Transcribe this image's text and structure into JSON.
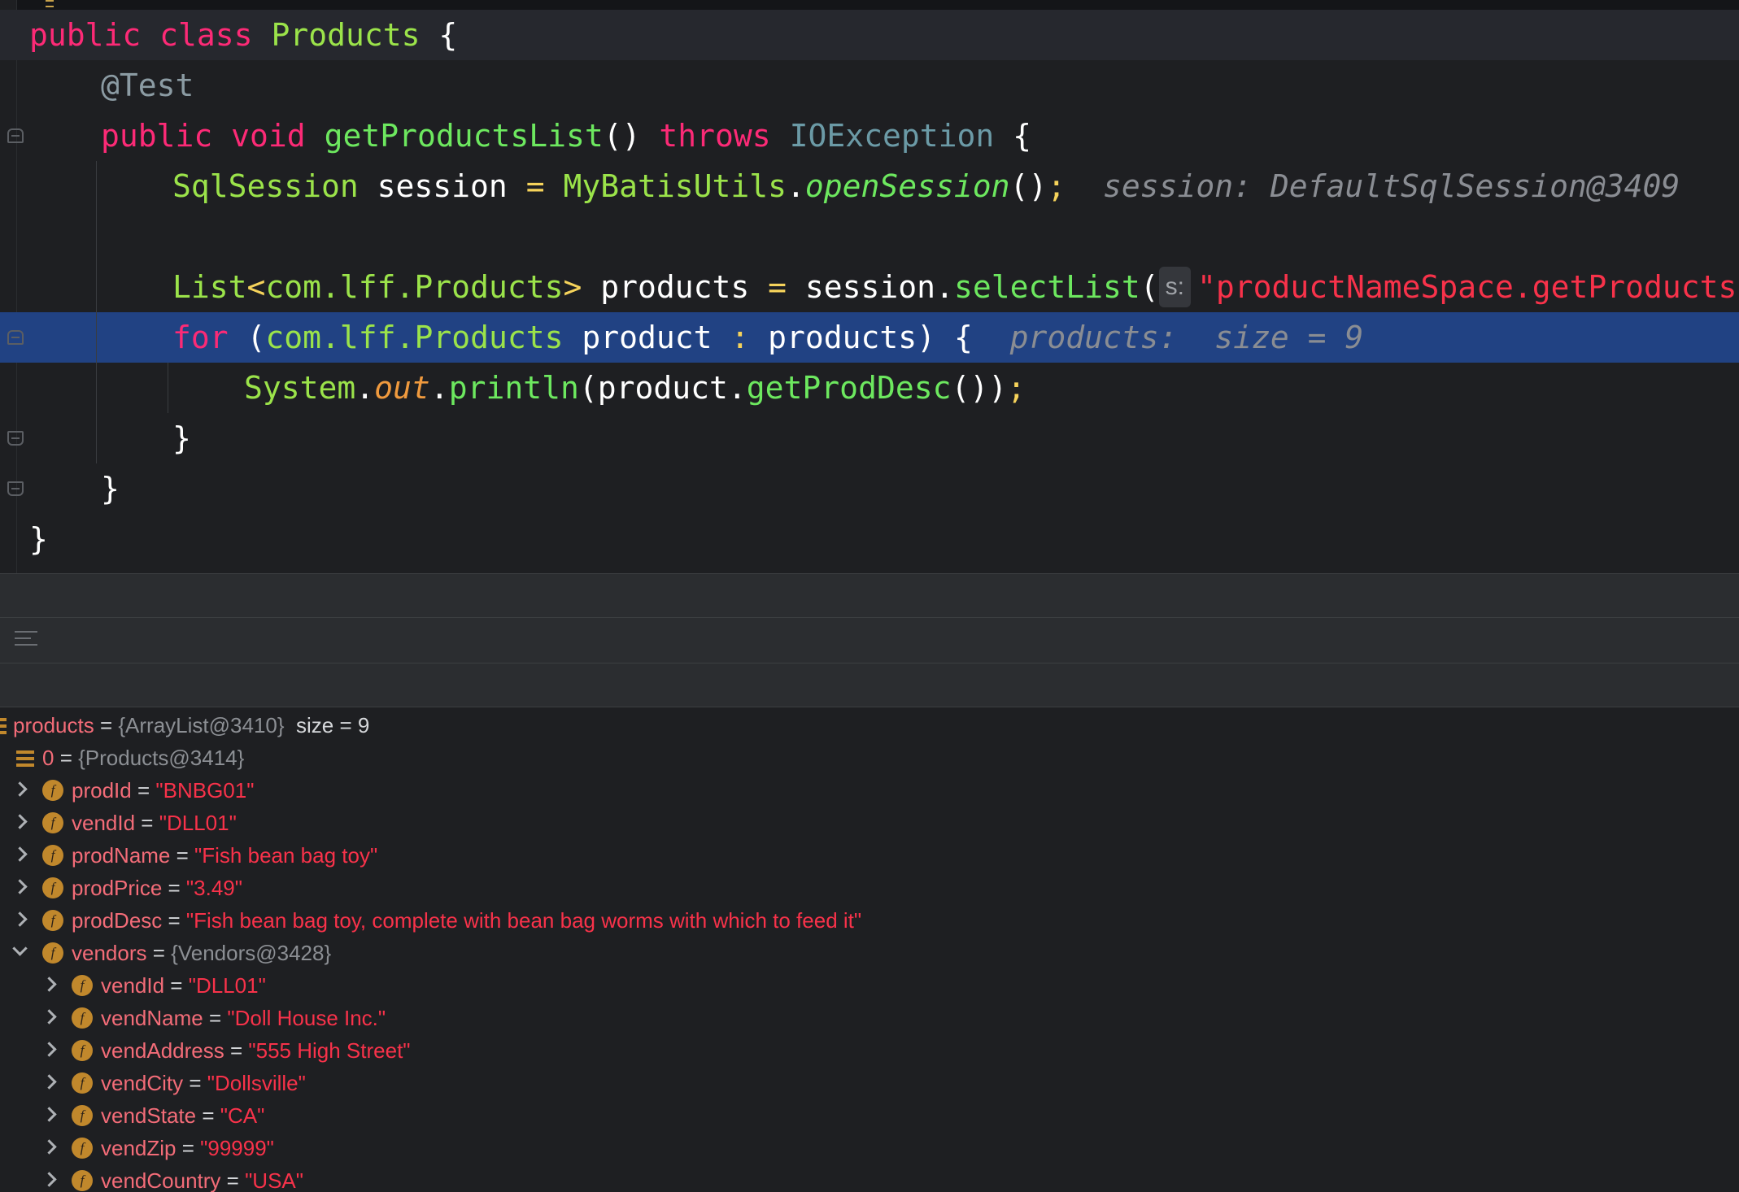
{
  "editor": {
    "lines": [
      {
        "id": "l1",
        "parts": [
          [
            "kw",
            "public"
          ],
          [
            "pl",
            " "
          ],
          [
            "kw",
            "class"
          ],
          [
            "pl",
            " "
          ],
          [
            "cls",
            "Products"
          ],
          [
            "pl",
            " "
          ],
          [
            "br",
            "{"
          ]
        ]
      },
      {
        "id": "l2",
        "parts": [
          [
            "ann",
            "@Test"
          ]
        ]
      },
      {
        "id": "l3",
        "parts": [
          [
            "kw",
            "public"
          ],
          [
            "pl",
            " "
          ],
          [
            "kw",
            "void"
          ],
          [
            "pl",
            " "
          ],
          [
            "fn",
            "getProductsList"
          ],
          [
            "br",
            "()"
          ],
          [
            "pl",
            " "
          ],
          [
            "kw",
            "throws"
          ],
          [
            "pl",
            " "
          ],
          [
            "exc",
            "IOException"
          ],
          [
            "pl",
            " "
          ],
          [
            "br",
            "{"
          ]
        ]
      },
      {
        "id": "l4",
        "parts": [
          [
            "cls",
            "SqlSession"
          ],
          [
            "pl",
            " session "
          ],
          [
            "op",
            "="
          ],
          [
            "pl",
            " "
          ],
          [
            "cls",
            "MyBatisUtils"
          ],
          [
            "pl",
            "."
          ],
          [
            "fni",
            "openSession"
          ],
          [
            "br",
            "()"
          ],
          [
            "op",
            ";"
          ],
          [
            "pl",
            "  "
          ],
          [
            "hint",
            "session: DefaultSqlSession@3409"
          ]
        ]
      },
      {
        "id": "l5",
        "parts": []
      },
      {
        "id": "l6",
        "parts": [
          [
            "cls",
            "List"
          ],
          [
            "op",
            "<"
          ],
          [
            "cls",
            "com.lff.Products"
          ],
          [
            "op",
            ">"
          ],
          [
            "pl",
            " products "
          ],
          [
            "op",
            "="
          ],
          [
            "pl",
            " session"
          ],
          [
            "pl",
            "."
          ],
          [
            "fn",
            "selectList"
          ],
          [
            "br",
            "("
          ],
          [
            "param",
            "s:"
          ],
          [
            "str",
            "\"productNameSpace.getProducts\""
          ],
          [
            "br",
            ")"
          ],
          [
            "op",
            ";"
          ]
        ]
      },
      {
        "id": "l7",
        "parts": [
          [
            "kw",
            "for"
          ],
          [
            "pl",
            " "
          ],
          [
            "br",
            "("
          ],
          [
            "cls",
            "com.lff.Products"
          ],
          [
            "pl",
            " product "
          ],
          [
            "op",
            ":"
          ],
          [
            "pl",
            " products"
          ],
          [
            "br",
            ")"
          ],
          [
            "pl",
            " "
          ],
          [
            "br",
            "{"
          ],
          [
            "pl",
            "  "
          ],
          [
            "hint",
            "products:  size = 9"
          ]
        ]
      },
      {
        "id": "l8",
        "parts": [
          [
            "cls",
            "System"
          ],
          [
            "pl",
            "."
          ],
          [
            "fld",
            "out"
          ],
          [
            "pl",
            "."
          ],
          [
            "fn",
            "println"
          ],
          [
            "br",
            "("
          ],
          [
            "pl",
            "product"
          ],
          [
            "pl",
            "."
          ],
          [
            "fn",
            "getProdDesc"
          ],
          [
            "br",
            "())"
          ],
          [
            "op",
            ";"
          ]
        ]
      },
      {
        "id": "l9",
        "parts": [
          [
            "br",
            "}"
          ]
        ]
      },
      {
        "id": "l10",
        "parts": [
          [
            "br",
            "}"
          ]
        ]
      },
      {
        "id": "l11",
        "parts": [
          [
            "br",
            "}"
          ]
        ]
      }
    ]
  },
  "variables": {
    "rows": [
      {
        "id": "v0",
        "icon": "list",
        "chev": "none",
        "name": "products",
        "eq": " = ",
        "ref": "{ArrayList@3410}",
        "extra": "  size = 9"
      },
      {
        "id": "v1",
        "icon": "list",
        "chev": "none",
        "name": "0",
        "eq": " = ",
        "ref": "{Products@3414}"
      },
      {
        "id": "v2",
        "icon": "field",
        "chev": "closed",
        "name": "prodId",
        "eq": " = ",
        "sval": "\"BNBG01\""
      },
      {
        "id": "v3",
        "icon": "field",
        "chev": "closed",
        "name": "vendId",
        "eq": " = ",
        "sval": "\"DLL01\""
      },
      {
        "id": "v4",
        "icon": "field",
        "chev": "closed",
        "name": "prodName",
        "eq": " = ",
        "sval": "\"Fish bean bag toy\""
      },
      {
        "id": "v5",
        "icon": "field",
        "chev": "closed",
        "name": "prodPrice",
        "eq": " = ",
        "sval": "\"3.49\""
      },
      {
        "id": "v6",
        "icon": "field",
        "chev": "closed",
        "name": "prodDesc",
        "eq": " = ",
        "sval": "\"Fish bean bag toy, complete with bean bag worms with which to feed it\""
      },
      {
        "id": "v7",
        "icon": "field",
        "chev": "open",
        "name": "vendors",
        "eq": " = ",
        "ref": "{Vendors@3428}"
      },
      {
        "id": "v8",
        "icon": "field",
        "chev": "closed",
        "name": "vendId",
        "eq": " = ",
        "sval": "\"DLL01\""
      },
      {
        "id": "v9",
        "icon": "field",
        "chev": "closed",
        "name": "vendName",
        "eq": " = ",
        "sval": "\"Doll House Inc.\""
      },
      {
        "id": "v10",
        "icon": "field",
        "chev": "closed",
        "name": "vendAddress",
        "eq": " = ",
        "sval": "\"555 High Street\""
      },
      {
        "id": "v11",
        "icon": "field",
        "chev": "closed",
        "name": "vendCity",
        "eq": " = ",
        "sval": "\"Dollsville\""
      },
      {
        "id": "v12",
        "icon": "field",
        "chev": "closed",
        "name": "vendState",
        "eq": " = ",
        "sval": "\"CA\""
      },
      {
        "id": "v13",
        "icon": "field",
        "chev": "closed",
        "name": "vendZip",
        "eq": " = ",
        "sval": "\"99999\""
      },
      {
        "id": "v14",
        "icon": "field",
        "chev": "closed",
        "name": "vendCountry",
        "eq": " = ",
        "sval": "\"USA\""
      }
    ],
    "field_icon_letter": "f"
  },
  "colors": {
    "keyword": "#fc2a76",
    "class": "#9be34a",
    "string": "#f8324a",
    "execution_line": "#214283",
    "field_icon": "#c1882c"
  }
}
